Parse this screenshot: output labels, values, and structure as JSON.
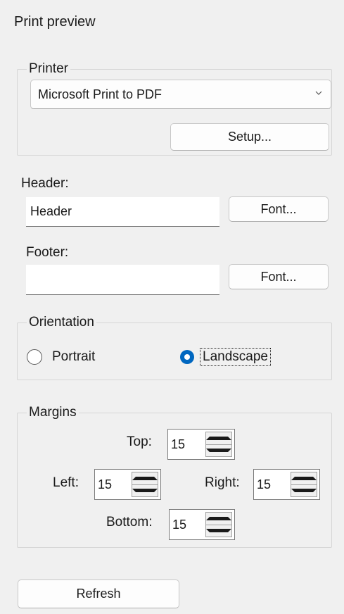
{
  "window": {
    "title": "Print preview"
  },
  "printer": {
    "legend": "Printer",
    "selected": "Microsoft Print to PDF",
    "setup_label": "Setup..."
  },
  "header": {
    "label": "Header:",
    "value": "Header",
    "font_label": "Font..."
  },
  "footer": {
    "label": "Footer:",
    "value": "",
    "font_label": "Font..."
  },
  "orientation": {
    "legend": "Orientation",
    "portrait_label": "Portrait",
    "landscape_label": "Landscape",
    "selected": "Landscape"
  },
  "margins": {
    "legend": "Margins",
    "top_label": "Top:",
    "top_value": "15",
    "left_label": "Left:",
    "left_value": "15",
    "right_label": "Right:",
    "right_value": "15",
    "bottom_label": "Bottom:",
    "bottom_value": "15"
  },
  "refresh_label": "Refresh",
  "colors": {
    "accent": "#0067c0",
    "background": "#f0f0f0"
  }
}
